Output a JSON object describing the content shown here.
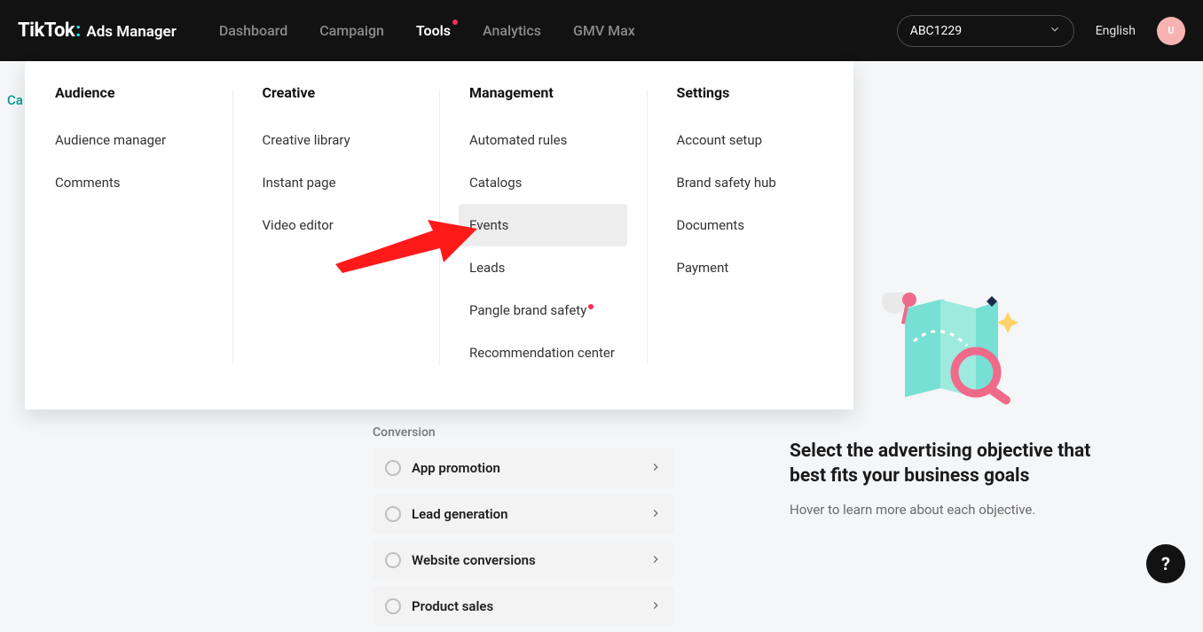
{
  "header": {
    "logo_main": "TikTok",
    "logo_sub": "Ads Manager",
    "nav": {
      "dashboard": "Dashboard",
      "campaign": "Campaign",
      "tools": "Tools",
      "analytics": "Analytics",
      "gmv_max": "GMV Max"
    },
    "account": "ABC1229",
    "language": "English",
    "avatar_initial": "U"
  },
  "breadcrumb": "Ca",
  "tools_menu": {
    "audience": {
      "head": "Audience",
      "items": [
        "Audience manager",
        "Comments"
      ]
    },
    "creative": {
      "head": "Creative",
      "items": [
        "Creative library",
        "Instant page",
        "Video editor"
      ]
    },
    "management": {
      "head": "Management",
      "items": [
        "Automated rules",
        "Catalogs",
        "Events",
        "Leads",
        "Pangle brand safety",
        "Recommendation center"
      ],
      "hover_index": 2,
      "dot_index": 4
    },
    "settings": {
      "head": "Settings",
      "items": [
        "Account setup",
        "Brand safety hub",
        "Documents",
        "Payment"
      ]
    }
  },
  "objectives": {
    "section": "Conversion",
    "items": [
      "App promotion",
      "Lead generation",
      "Website conversions",
      "Product sales"
    ]
  },
  "info": {
    "title": "Select the advertising objective that best fits your business goals",
    "sub": "Hover to learn more about each objective."
  },
  "fab": "?"
}
